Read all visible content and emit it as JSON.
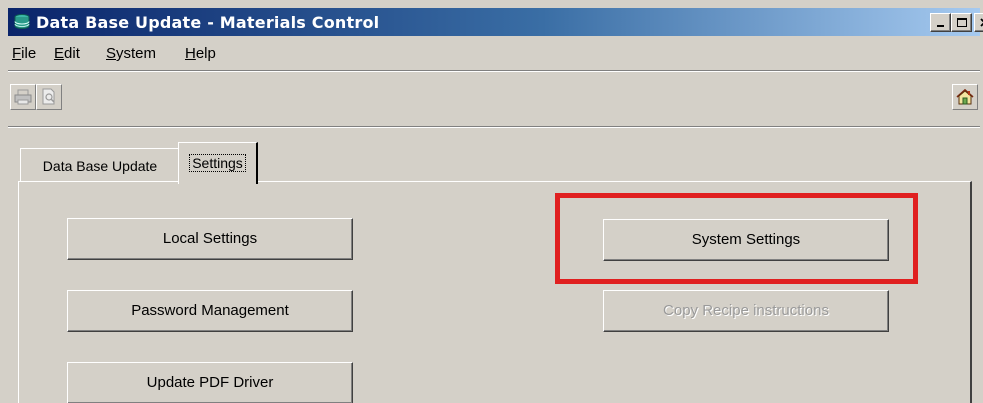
{
  "window": {
    "title": "Data Base Update - Materials Control",
    "app_icon": "database-icon",
    "caption_buttons": [
      "minimize-icon",
      "maximize-icon",
      "close-icon"
    ]
  },
  "menu": {
    "file": {
      "mnemonic": "F",
      "rest": "ile"
    },
    "edit": {
      "mnemonic": "E",
      "rest": "dit"
    },
    "system": {
      "mnemonic": "S",
      "rest": "ystem"
    },
    "help": {
      "mnemonic": "H",
      "rest": "elp"
    }
  },
  "toolbar": {
    "buttons": [
      "print-icon",
      "print-preview-icon",
      "home-icon"
    ]
  },
  "tabs": {
    "data_base_update": "Data Base Update",
    "settings": "Settings",
    "active": "Settings"
  },
  "settings_panel": {
    "local_settings": "Local Settings",
    "password_management": "Password Management",
    "update_pdf_driver": "Update PDF Driver",
    "system_settings": "System Settings",
    "copy_recipe_instructions": "Copy Recipe instructions"
  },
  "annotation": {
    "highlight_color": "#e02020",
    "highlighted_element": "System Settings"
  }
}
